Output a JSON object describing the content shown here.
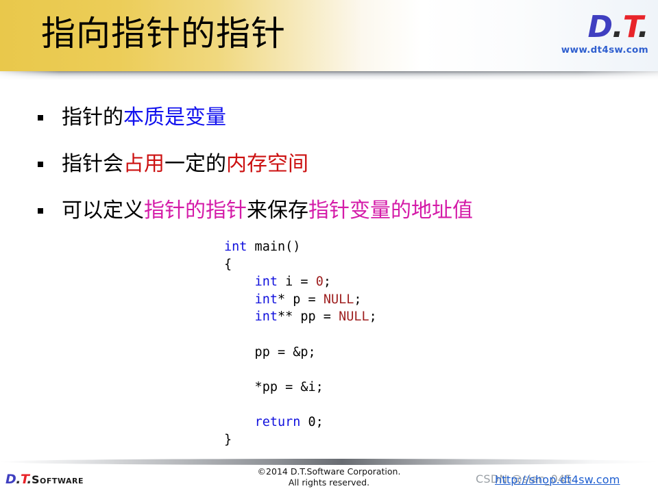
{
  "header": {
    "title": "指向指针的指针",
    "logo": {
      "d": "D",
      "dot1": ".",
      "t": "T",
      "dot2": ".",
      "url": "www.dt4sw.com"
    },
    "colors": {
      "gold": "#e9c84b",
      "logo_blue": "#3f3fc0",
      "logo_red": "#e8242a",
      "url_blue": "#2f5fcf"
    }
  },
  "content": {
    "bullets": [
      {
        "marker": "square",
        "segments": [
          {
            "text": "指针的",
            "color": "black"
          },
          {
            "text": "本质是变量",
            "color": "blue"
          }
        ]
      },
      {
        "marker": "square",
        "segments": [
          {
            "text": "指针会",
            "color": "black"
          },
          {
            "text": "占用",
            "color": "red"
          },
          {
            "text": "一定的",
            "color": "black"
          },
          {
            "text": "内存空间",
            "color": "red"
          }
        ]
      },
      {
        "marker": "square",
        "segments": [
          {
            "text": "可以定义",
            "color": "black"
          },
          {
            "text": "指针的指针",
            "color": "magenta"
          },
          {
            "text": "来保存",
            "color": "black"
          },
          {
            "text": "指针变量的地址值",
            "color": "magenta"
          }
        ]
      }
    ],
    "code": {
      "language": "c",
      "lines": [
        [
          {
            "t": "int",
            "c": "kw"
          },
          {
            "t": " main()",
            "c": "pln"
          }
        ],
        [
          {
            "t": "{",
            "c": "pln"
          }
        ],
        [
          {
            "t": "    ",
            "c": "pln"
          },
          {
            "t": "int",
            "c": "kw"
          },
          {
            "t": " i = ",
            "c": "pln"
          },
          {
            "t": "0",
            "c": "num"
          },
          {
            "t": ";",
            "c": "pln"
          }
        ],
        [
          {
            "t": "    ",
            "c": "pln"
          },
          {
            "t": "int",
            "c": "kw"
          },
          {
            "t": "* p = ",
            "c": "pln"
          },
          {
            "t": "NULL",
            "c": "num"
          },
          {
            "t": ";",
            "c": "pln"
          }
        ],
        [
          {
            "t": "    ",
            "c": "pln"
          },
          {
            "t": "int",
            "c": "kw"
          },
          {
            "t": "** pp = ",
            "c": "pln"
          },
          {
            "t": "NULL",
            "c": "num"
          },
          {
            "t": ";",
            "c": "pln"
          }
        ],
        [
          {
            "t": " ",
            "c": "pln"
          }
        ],
        [
          {
            "t": "    pp = &p;",
            "c": "pln"
          }
        ],
        [
          {
            "t": " ",
            "c": "pln"
          }
        ],
        [
          {
            "t": "    *pp = &i;",
            "c": "pln"
          }
        ],
        [
          {
            "t": " ",
            "c": "pln"
          }
        ],
        [
          {
            "t": "    ",
            "c": "pln"
          },
          {
            "t": "return",
            "c": "kw"
          },
          {
            "t": " 0;",
            "c": "pln"
          }
        ],
        [
          {
            "t": "}",
            "c": "pln"
          }
        ]
      ]
    }
  },
  "footer": {
    "logo": {
      "d": "D",
      "dot1": ".",
      "t": "T",
      "dot2": ".",
      "suffix": "Software"
    },
    "copyright_line1": "©2014 D.T.Software Corporation.",
    "copyright_line2": "All rights reserved.",
    "watermark_csdn": "CSDN @sian_045",
    "watermark_link": "http://shop.dt4sw.com"
  }
}
